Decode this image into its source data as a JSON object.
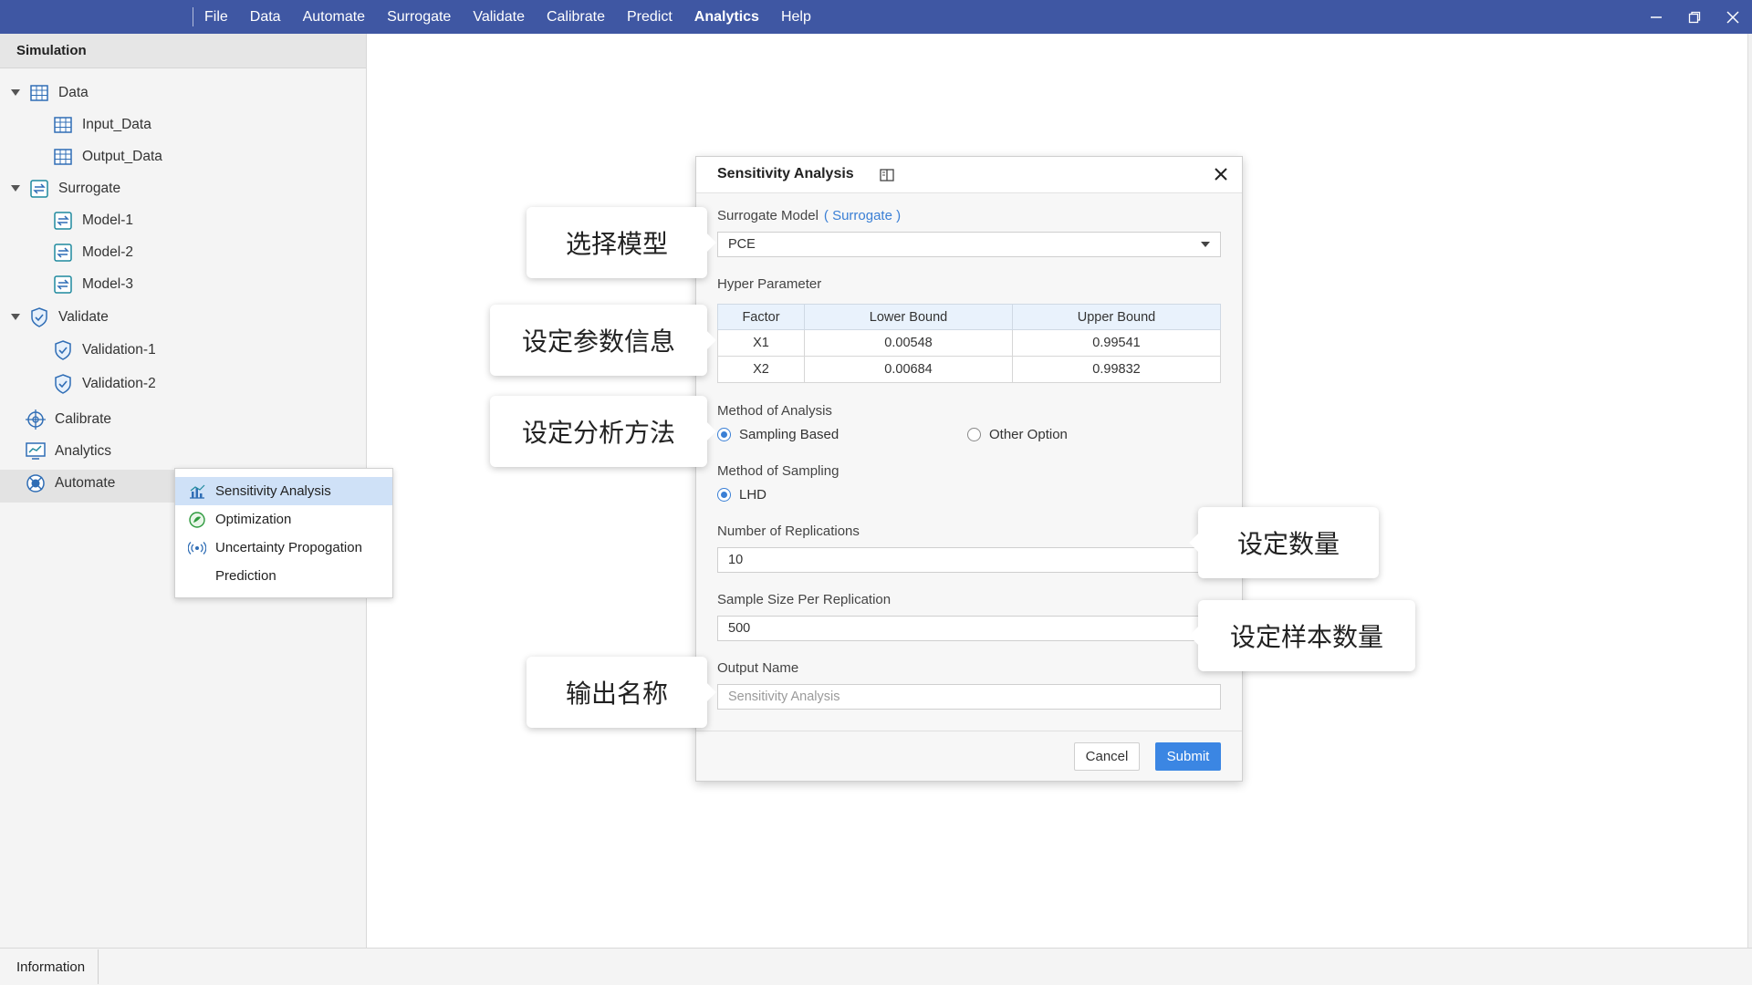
{
  "menu": [
    "File",
    "Data",
    "Automate",
    "Surrogate",
    "Validate",
    "Calibrate",
    "Predict",
    "Analytics",
    "Help"
  ],
  "menu_active": "Analytics",
  "sidebar": {
    "title": "Simulation",
    "data": {
      "label": "Data",
      "children": [
        "Input_Data",
        "Output_Data"
      ]
    },
    "surrogate": {
      "label": "Surrogate",
      "children": [
        "Model-1",
        "Model-2",
        "Model-3"
      ]
    },
    "validate": {
      "label": "Validate",
      "children": [
        "Validation-1",
        "Validation-2"
      ]
    },
    "calibrate": "Calibrate",
    "analytics": "Analytics",
    "automate": "Automate"
  },
  "context_menu": [
    "Sensitivity Analysis",
    "Optimization",
    "Uncertainty Propogation",
    "Prediction"
  ],
  "status": {
    "tab": "Information"
  },
  "dialog": {
    "title": "Sensitivity Analysis",
    "surrogate_label": "Surrogate Model",
    "surrogate_link": "( Surrogate )",
    "surrogate_value": "PCE",
    "hyper_label": "Hyper Parameter",
    "table": {
      "headers": [
        "Factor",
        "Lower Bound",
        "Upper Bound"
      ],
      "rows": [
        [
          "X1",
          "0.00548",
          "0.99541"
        ],
        [
          "X2",
          "0.00684",
          "0.99832"
        ]
      ]
    },
    "method_label": "Method of Analysis",
    "method_options": [
      "Sampling Based",
      "Other Option"
    ],
    "sampling_label": "Method of Sampling",
    "sampling_option": "LHD",
    "replications_label": "Number of Replications",
    "replications_value": "10",
    "sample_size_label": "Sample Size Per Replication",
    "sample_size_value": "500",
    "output_label": "Output Name",
    "output_placeholder": "Sensitivity Analysis",
    "cancel": "Cancel",
    "submit": "Submit"
  },
  "callouts": {
    "model": "选择模型",
    "params": "设定参数信息",
    "method": "设定分析方法",
    "count": "设定数量",
    "samples": "设定样本数量",
    "output": "输出名称"
  }
}
